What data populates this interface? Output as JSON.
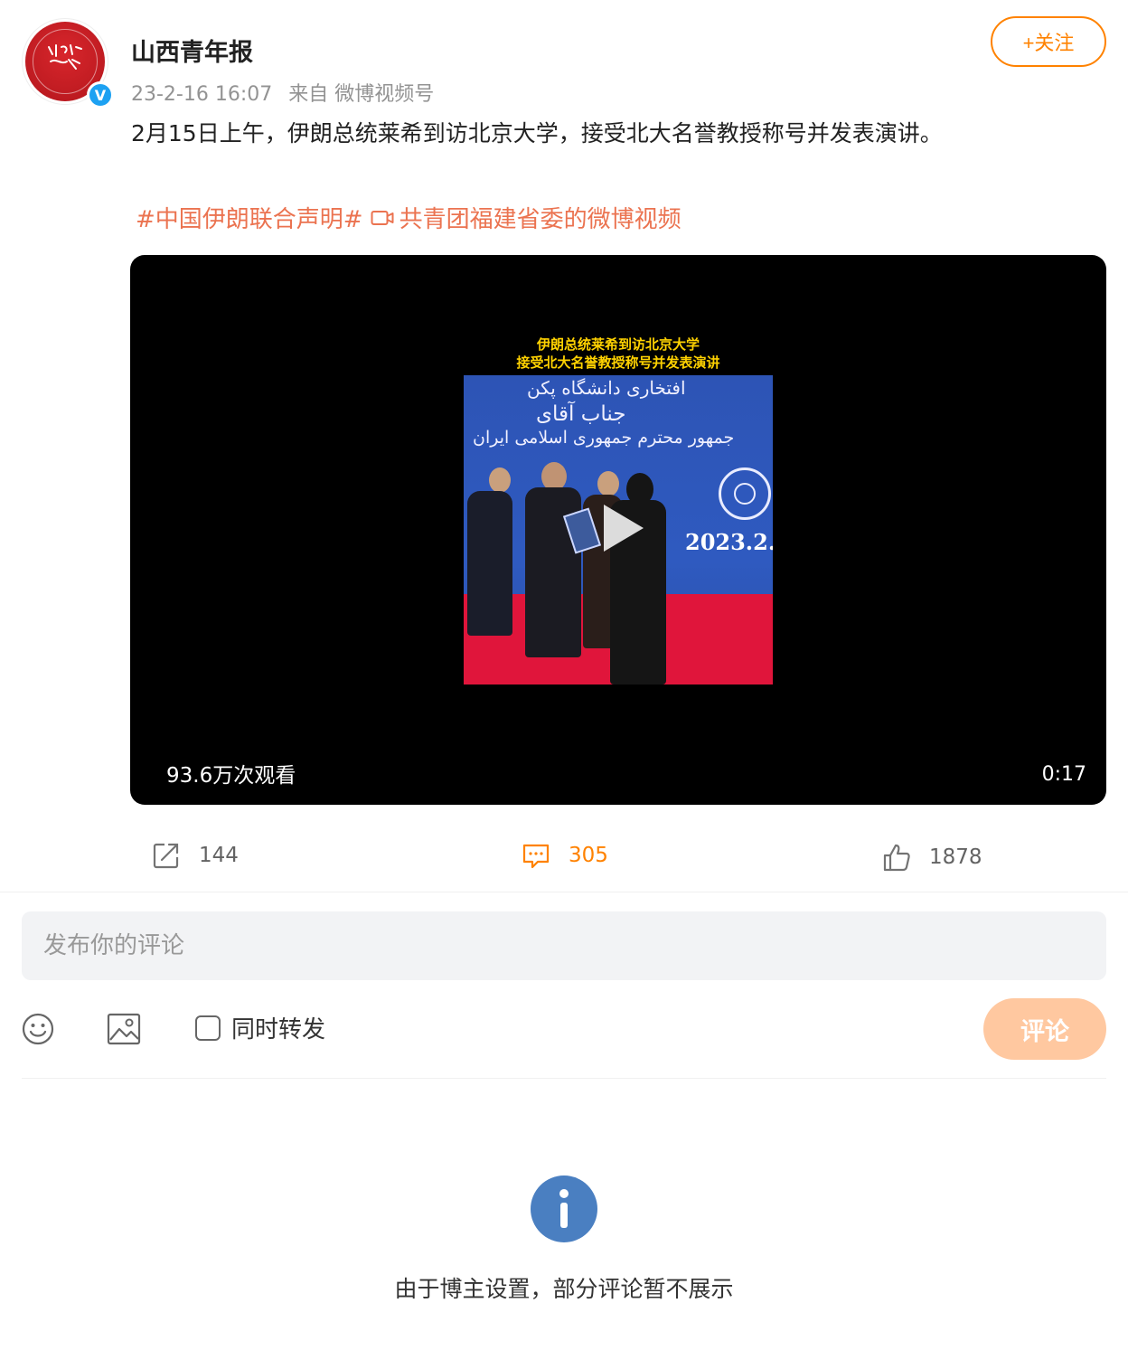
{
  "post": {
    "author": "山西青年报",
    "verified": true,
    "timestamp": "23-2-16 16:07",
    "source": "来自 微博视频号",
    "follow_label": "+关注",
    "text": "2月15日上午，伊朗总统莱希到访北京大学，接受北大名誉教授称号并发表演讲。",
    "tag": "#中国伊朗联合声明#",
    "video_link": "共青团福建省委的微博视频"
  },
  "video": {
    "caption_line1": "伊朗总统莱希到访北京大学",
    "caption_line2": "接受北大名誉教授称号并发表演讲",
    "frame_date": "2023.2.",
    "persian_line1": "افتخاری دانشگاه پکن",
    "persian_line2": "جمهور محترم جمهوری اسلامی ایران",
    "persian_line3": "جناب آقای",
    "views": "93.6万次观看",
    "duration": "0:17"
  },
  "actions": {
    "reposts": "144",
    "comments": "305",
    "likes": "1878"
  },
  "composer": {
    "placeholder": "发布你的评论",
    "repost_label": "同时转发",
    "submit_label": "评论"
  },
  "notice": "由于博主设置，部分评论暂不展示",
  "colors": {
    "accent": "#ff8200",
    "tag": "#eb7350",
    "verified": "#1da1f2",
    "info": "#4a7fc1"
  }
}
